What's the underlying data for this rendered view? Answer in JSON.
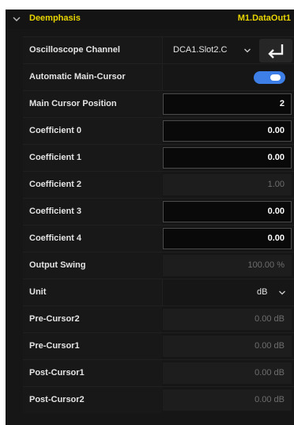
{
  "header": {
    "title": "Deemphasis",
    "target": "M1.DataOut1",
    "expand_icon": "chevron-down-icon"
  },
  "rows": {
    "oscilloscope_channel": {
      "label": "Oscilloscope Channel",
      "value": "DCA1.Slot2.C",
      "enter_icon": "enter-return-icon"
    },
    "auto_main_cursor": {
      "label": "Automatic Main-Cursor",
      "enabled": true
    },
    "main_cursor_position": {
      "label": "Main Cursor Position",
      "value": "2"
    },
    "coefficient_0": {
      "label": "Coefficient 0",
      "value": "0.00"
    },
    "coefficient_1": {
      "label": "Coefficient 1",
      "value": "0.00"
    },
    "coefficient_2": {
      "label": "Coefficient 2",
      "value": "1.00"
    },
    "coefficient_3": {
      "label": "Coefficient 3",
      "value": "0.00"
    },
    "coefficient_4": {
      "label": "Coefficient 4",
      "value": "0.00"
    },
    "output_swing": {
      "label": "Output Swing",
      "value": "100.00 %"
    },
    "unit": {
      "label": "Unit",
      "value": "dB"
    },
    "pre_cursor2": {
      "label": "Pre-Cursor2",
      "value": "0.00 dB"
    },
    "pre_cursor1": {
      "label": "Pre-Cursor1",
      "value": "0.00 dB"
    },
    "post_cursor1": {
      "label": "Post-Cursor1",
      "value": "0.00 dB"
    },
    "post_cursor2": {
      "label": "Post-Cursor2",
      "value": "0.00 dB"
    }
  },
  "colors": {
    "accent": "#e9d600",
    "toggle_on": "#3d7fe6",
    "panel_bg": "#161616"
  }
}
